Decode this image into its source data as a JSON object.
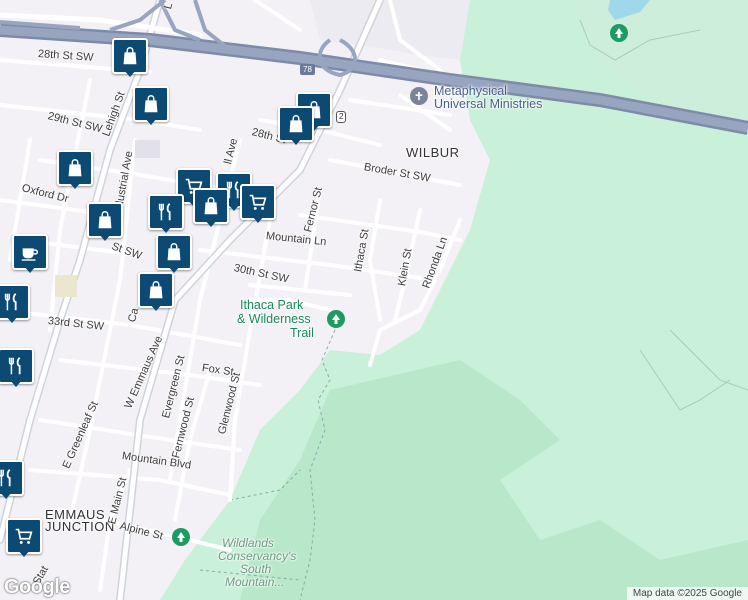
{
  "map": {
    "attribution": "Map data ©2025 Google",
    "logo": "Google",
    "colors": {
      "background": "#f3f1f6",
      "park": "#c9f0d8",
      "park_dark": "#b6e9c9",
      "road": "#ffffff",
      "highway": "#8c9ab8",
      "water": "#9fd8ea",
      "pin": "#0d4a73",
      "park_label": "#1a8a5a"
    },
    "area_labels": {
      "wilbur": "WILBUR",
      "emmaus_1": "EMMAUS",
      "emmaus_2": "JUNCTION"
    },
    "poi_labels": {
      "metaphysical_1": "Metaphysical",
      "metaphysical_2": "Universal Ministries",
      "ithaca_1": "Ithaca Park",
      "ithaca_2": "& Wilderness",
      "ithaca_3": "Trail",
      "wildlands_1": "Wildlands",
      "wildlands_2": "Conservancy's",
      "wildlands_3": "South",
      "wildlands_4": "Mountain..."
    },
    "highway_shield": "78",
    "route_shield": "2",
    "streets": {
      "s28th_sw": "28th St SW",
      "s29th": "29th St SW",
      "s28th_right": "28th St",
      "lehigh": "Lehigh St",
      "industrial": "Industrial Ave",
      "oxford": "Oxford Dr",
      "broder": "Broder St SW",
      "fernor": "Fernor St",
      "mountain_ln": "Mountain Ln",
      "ithaca_st": "Ithaca St",
      "klein": "Klein St",
      "rhonda": "Rhonda Ln",
      "s30th": "30th St SW",
      "s33rd": "33rd St SW",
      "w_emmaus": "W Emmaus Ave",
      "evergreen": "Evergreen St",
      "fox": "Fox St",
      "fernwood": "Fernwood St",
      "glenwood": "Glenwood St",
      "e_greenleaf": "E Greenleaf St",
      "mountain_blvd": "Mountain Blvd",
      "e_main": "E Main St",
      "alpine": "Alpine St",
      "hall_ave": "ll Ave",
      "st_sw_left": "St SW",
      "ca": "Ca",
      "ls_top": "L",
      "stat": "Stat"
    },
    "markers": [
      {
        "type": "shopping",
        "icon": "shopping-bag-icon"
      },
      {
        "type": "shopping",
        "icon": "shopping-bag-icon"
      },
      {
        "type": "shopping",
        "icon": "shopping-bag-icon"
      },
      {
        "type": "shopping",
        "icon": "shopping-bag-icon"
      },
      {
        "type": "grocery",
        "icon": "shopping-cart-icon"
      },
      {
        "type": "restaurant",
        "icon": "fork-knife-icon"
      },
      {
        "type": "grocery",
        "icon": "shopping-cart-icon"
      },
      {
        "type": "restaurant",
        "icon": "fork-knife-icon"
      },
      {
        "type": "shopping",
        "icon": "shopping-bag-icon"
      },
      {
        "type": "shopping",
        "icon": "shopping-bag-icon"
      },
      {
        "type": "shopping",
        "icon": "shopping-bag-icon"
      },
      {
        "type": "shopping",
        "icon": "shopping-bag-icon"
      },
      {
        "type": "cafe",
        "icon": "coffee-cup-icon"
      },
      {
        "type": "restaurant",
        "icon": "fork-knife-icon"
      },
      {
        "type": "restaurant",
        "icon": "fork-knife-icon"
      },
      {
        "type": "restaurant",
        "icon": "fork-knife-icon"
      },
      {
        "type": "grocery",
        "icon": "shopping-cart-icon"
      },
      {
        "type": "shopping",
        "icon": "shopping-bag-icon"
      }
    ]
  }
}
